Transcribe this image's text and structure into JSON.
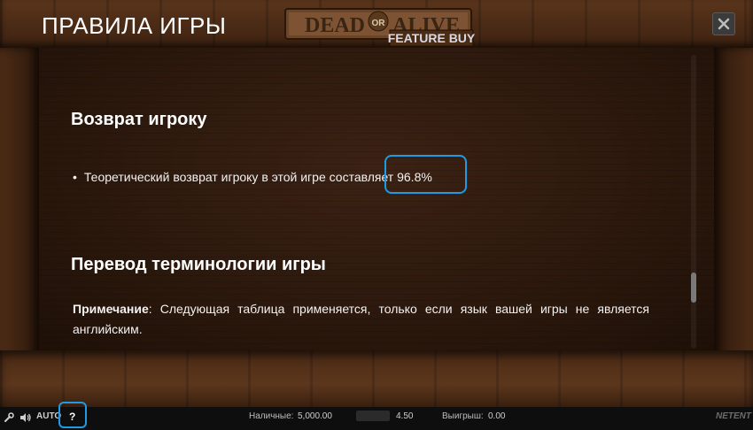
{
  "header": {
    "title": "ПРАВИЛА ИГРЫ",
    "logo": {
      "line1": "DEAD",
      "or": "OR",
      "line1b": "ALIVE",
      "line2": "FEATURE BUY"
    },
    "close_icon": "close-icon"
  },
  "content": {
    "section1": {
      "heading": "Возврат игроку",
      "bullet_text": "Теоретический возврат игроку в этой игре составляет",
      "rtp_value": "96.8%"
    },
    "section2": {
      "heading": "Перевод терминологии игры",
      "note_label": "Примечание",
      "note_text": ": Следующая таблица применяется, только если язык вашей игры не является английским."
    }
  },
  "bottom_bar": {
    "auto_label": "AUTO",
    "help_label": "?",
    "balance_label": "Наличные:",
    "balance_value": "5,000.00",
    "bet_value": "4.50",
    "win_label": "Выигрыш:",
    "win_value": "0.00",
    "brand": "NETENT"
  },
  "colors": {
    "accent_highlight": "#1e9be3",
    "text": "#ffffff"
  }
}
